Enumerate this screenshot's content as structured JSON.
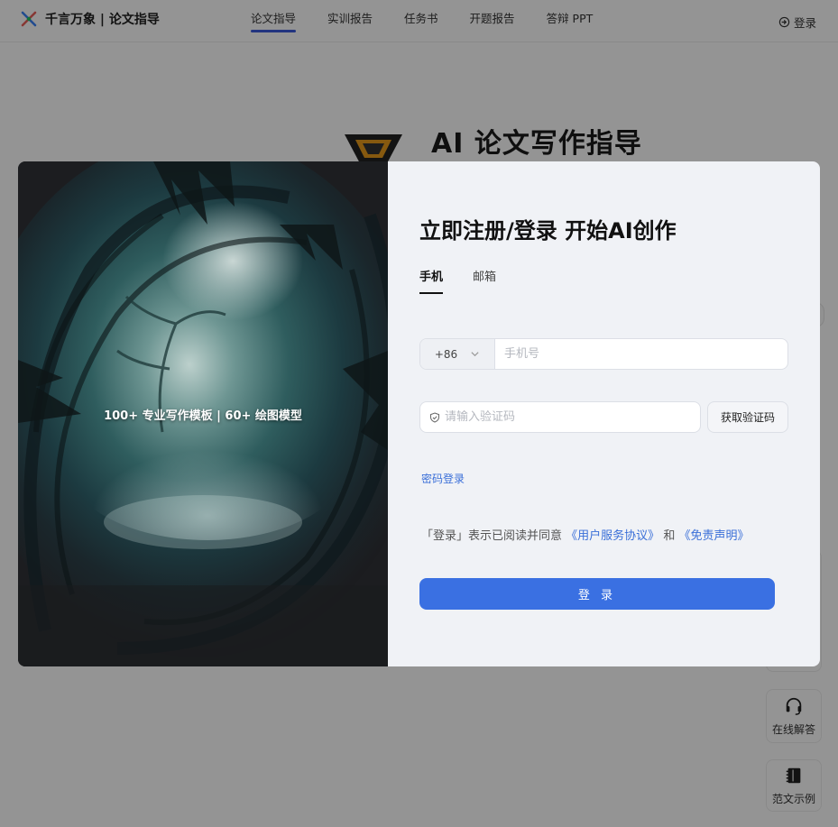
{
  "nav": {
    "brand": "千言万象 | 论文指导",
    "tabs": [
      "论文指导",
      "实训报告",
      "任务书",
      "开题报告",
      "答辩 PPT"
    ],
    "login": "登录"
  },
  "hero": {
    "title": "AI 论文写作指导"
  },
  "side": {
    "online_help": "在线解答",
    "examples": "范文示例"
  },
  "modal": {
    "promo": "100+ 专业写作模板 | 60+ 绘图模型",
    "title": "立即注册/登录 开始AI创作",
    "tabs": [
      "手机",
      "邮箱"
    ],
    "country_code": "+86",
    "phone_placeholder": "手机号",
    "code_placeholder": "请输入验证码",
    "get_code": "获取验证码",
    "password_login": "密码登录",
    "agree_prefix": "「登录」表示已阅读并同意",
    "agree_link1": "《用户服务协议》",
    "agree_and": "和",
    "agree_link2": "《免责声明》",
    "login_button": "登 录"
  },
  "colors": {
    "accent": "#3a70e2",
    "link": "#3a6fd8",
    "nav_underline": "#3b5bdb"
  }
}
